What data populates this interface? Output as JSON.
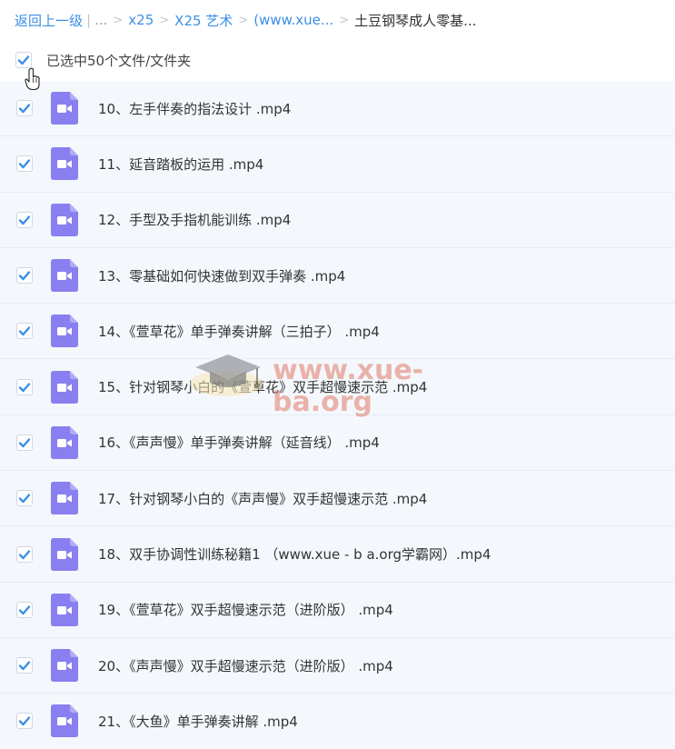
{
  "breadcrumb": {
    "back": "返回上一级",
    "ellipsis": "...",
    "items": [
      "x25",
      "X25 艺术",
      "(www.xue...",
      "土豆钢琴成人零基..."
    ]
  },
  "selection": {
    "label": "已选中50个文件/文件夹",
    "checked": true
  },
  "colors": {
    "accent": "#3b8fe6",
    "video_icon": "#8a7ff0",
    "row_bg": "#f4f8fd"
  },
  "files": [
    {
      "name": "10、左手伴奏的指法设计 .mp4",
      "icon": "video-file-icon",
      "checked": true
    },
    {
      "name": "11、延音踏板的运用 .mp4",
      "icon": "video-file-icon",
      "checked": true
    },
    {
      "name": "12、手型及手指机能训练 .mp4",
      "icon": "video-file-icon",
      "checked": true
    },
    {
      "name": "13、零基础如何快速做到双手弹奏 .mp4",
      "icon": "video-file-icon",
      "checked": true
    },
    {
      "name": "14、《萱草花》单手弹奏讲解（三拍子） .mp4",
      "icon": "video-file-icon",
      "checked": true
    },
    {
      "name": "15、针对钢琴小白的《萱草花》双手超慢速示范 .mp4",
      "icon": "video-file-icon",
      "checked": true
    },
    {
      "name": "16、《声声慢》单手弹奏讲解（延音线） .mp4",
      "icon": "video-file-icon",
      "checked": true
    },
    {
      "name": "17、针对钢琴小白的《声声慢》双手超慢速示范 .mp4",
      "icon": "video-file-icon",
      "checked": true
    },
    {
      "name": "18、双手协调性训练秘籍1 （www.xue - b a.org学霸网）.mp4",
      "icon": "video-file-icon",
      "checked": true
    },
    {
      "name": "19、《萱草花》双手超慢速示范（进阶版） .mp4",
      "icon": "video-file-icon",
      "checked": true
    },
    {
      "name": "20、《声声慢》双手超慢速示范（进阶版） .mp4",
      "icon": "video-file-icon",
      "checked": true
    },
    {
      "name": "21、《大鱼》单手弹奏讲解 .mp4",
      "icon": "video-file-icon",
      "checked": true
    }
  ],
  "watermark": {
    "text": "www.xue-ba.org"
  }
}
